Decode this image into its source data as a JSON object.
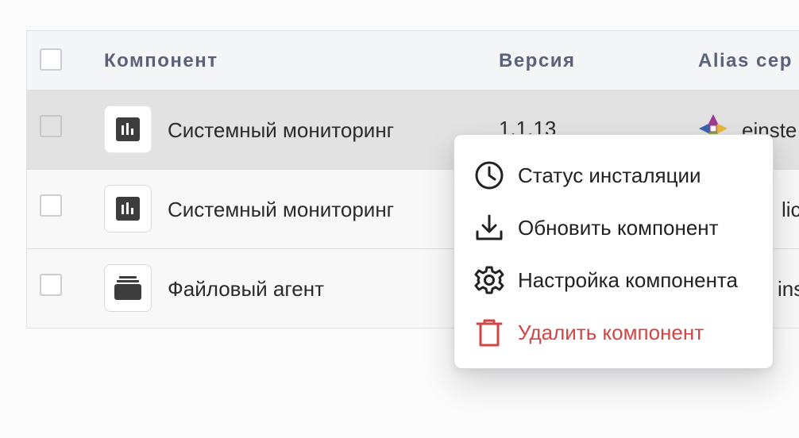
{
  "table": {
    "headers": {
      "component": "Компонент",
      "version": "Версия",
      "alias": "Alias сер"
    },
    "rows": [
      {
        "name": "Системный мониторинг",
        "version": "1.1.13",
        "alias": "einste",
        "icon": "chart-icon"
      },
      {
        "name": "Системный мониторинг",
        "version": "",
        "alias": "lich",
        "icon": "chart-icon"
      },
      {
        "name": "Файловый агент",
        "version": "",
        "alias": "inste",
        "icon": "archive-icon"
      }
    ]
  },
  "context_menu": {
    "items": [
      {
        "label": "Статус инсталяции",
        "icon": "clock-icon"
      },
      {
        "label": "Обновить компонент",
        "icon": "download-icon"
      },
      {
        "label": "Настройка компонента",
        "icon": "gear-icon"
      },
      {
        "label": "Удалить компонент",
        "icon": "trash-icon",
        "color": "#d14545"
      }
    ]
  },
  "colors": {
    "danger": "#d14545",
    "header_text": "#5a627a",
    "row_hover": "#e2e2e2"
  }
}
